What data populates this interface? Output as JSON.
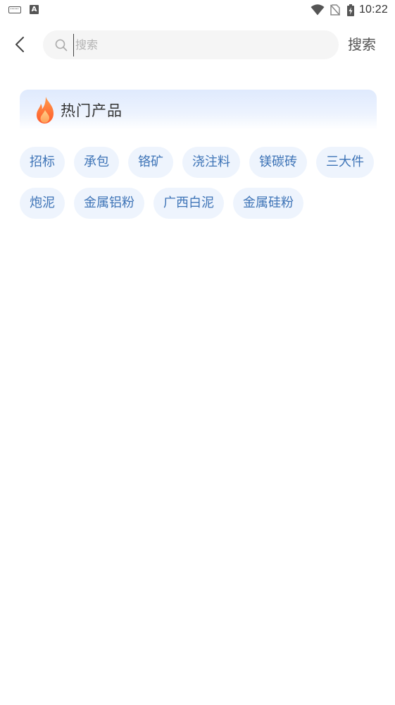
{
  "status_bar": {
    "time": "10:22",
    "icons": [
      "keyboard-icon",
      "a-letter-icon",
      "wifi-icon",
      "no-sim-icon",
      "battery-charging-icon"
    ]
  },
  "header": {
    "back_icon": "chevron-left-icon",
    "search": {
      "placeholder": "搜索",
      "value": "",
      "icon": "search-icon"
    },
    "search_button_label": "搜索"
  },
  "hot_products": {
    "title": "热门产品",
    "icon": "fire-icon",
    "tags": [
      "招标",
      "承包",
      "铬矿",
      "浇注料",
      "镁碳砖",
      "三大件",
      "炮泥",
      "金属铝粉",
      "广西白泥",
      "金属硅粉"
    ]
  },
  "colors": {
    "tag_background": "#eef4fd",
    "tag_text": "#3e74b7",
    "search_background": "#f5f5f5",
    "fire_orange": "#ff7a3d",
    "header_gradient_top": "#dfeafd"
  }
}
